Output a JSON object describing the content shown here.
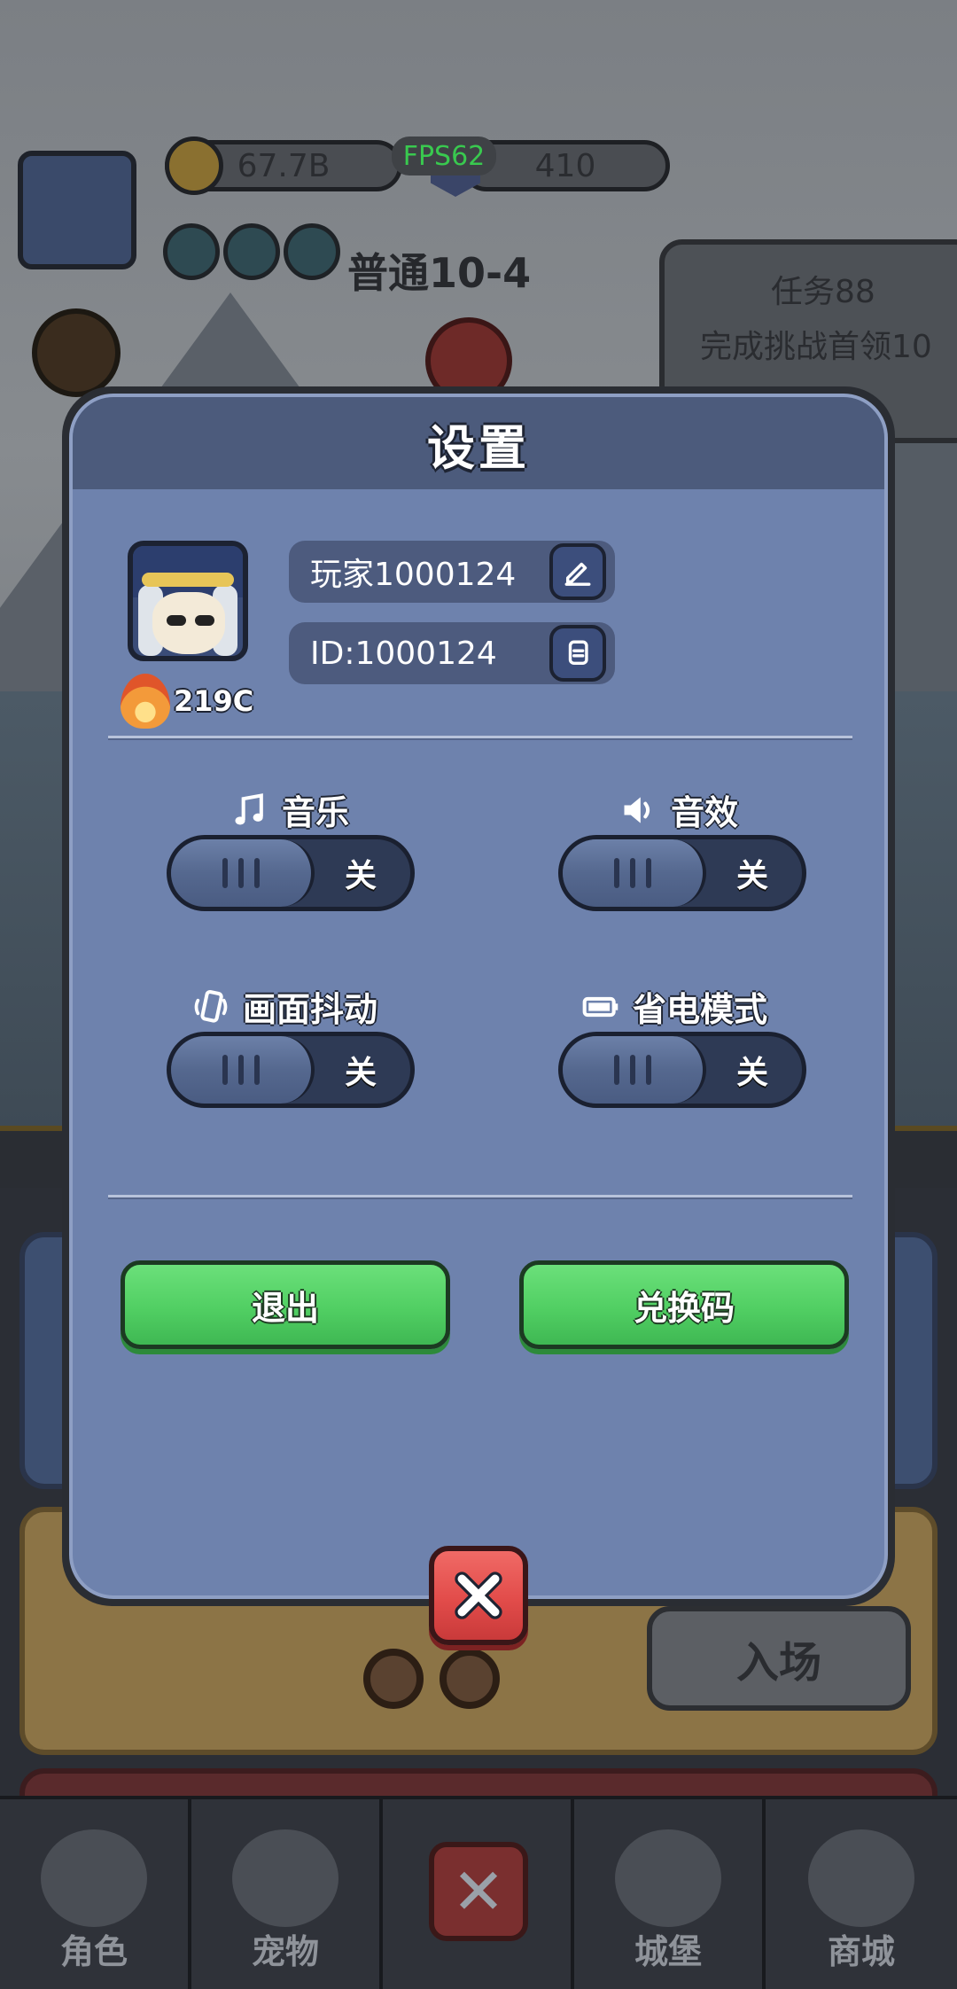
{
  "hud": {
    "coins": "67.7B",
    "fps": "FPS62",
    "gems": "410",
    "stage": "普通10-4",
    "quest_title": "任务88",
    "quest_desc": "完成挑战首领10"
  },
  "dialog": {
    "title": "设置",
    "player_name": "玩家1000124",
    "player_id": "ID:1000124",
    "power": "219C",
    "options": {
      "music_label": "音乐",
      "sfx_label": "音效",
      "shake_label": "画面抖动",
      "powersave_label": "省电模式",
      "music_state": "关",
      "sfx_state": "关",
      "shake_state": "关",
      "powersave_state": "关"
    },
    "exit_label": "退出",
    "redeem_label": "兑换码"
  },
  "background": {
    "enter_label": "入场"
  },
  "bottom_nav": {
    "items": [
      {
        "label": "角色"
      },
      {
        "label": "宠物"
      },
      {
        "label": ""
      },
      {
        "label": "城堡"
      },
      {
        "label": "商城"
      }
    ]
  },
  "colors": {
    "dialog_body": "#6e82ad",
    "dialog_header": "#4c5b7c",
    "green_button": "#51cf63",
    "close_button": "#e24c4a",
    "fps_text": "#39c94f"
  }
}
